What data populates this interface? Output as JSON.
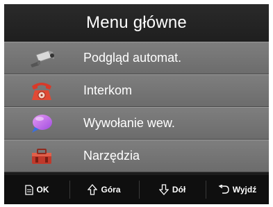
{
  "title": "Menu główne",
  "menu": {
    "items": [
      {
        "label": "Podgląd automat.",
        "icon": "camera-icon"
      },
      {
        "label": "Interkom",
        "icon": "telephone-icon"
      },
      {
        "label": "Wywołanie wew.",
        "icon": "chat-bubble-icon"
      },
      {
        "label": "Narzędzia",
        "icon": "toolbox-icon"
      }
    ]
  },
  "footer": {
    "ok_label": "OK",
    "up_label": "Góra",
    "down_label": "Dół",
    "exit_label": "Wyjdź"
  },
  "colors": {
    "title_bg": "#1f1f1f",
    "menu_item_bg": "#767676",
    "footer_bg": "#0f0f0f",
    "text": "#ffffff"
  }
}
